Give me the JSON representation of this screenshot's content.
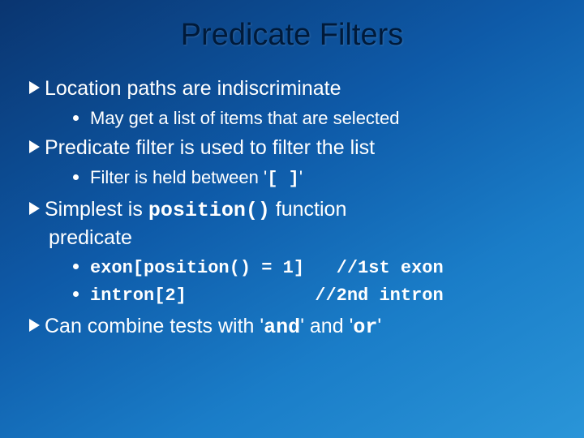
{
  "title": "Predicate Filters",
  "items": [
    {
      "text": "Location paths are indiscriminate",
      "subs": [
        {
          "text": "May get a list of items that are selected"
        }
      ]
    },
    {
      "text": "Predicate filter is used to filter the list",
      "subs": [
        {
          "prefix": "Filter is held between '",
          "code": "[ ]",
          "suffix": "'"
        }
      ]
    },
    {
      "prefix": "Simplest is ",
      "code": "position()",
      "suffix_line1": " function",
      "suffix_line2": "predicate",
      "subs": [
        {
          "code": "exon[position() = 1]   //1st exon"
        },
        {
          "code": "intron[2]            //2nd intron"
        }
      ]
    },
    {
      "prefix": "Can combine tests with '",
      "code1": "and",
      "mid": "' and '",
      "code2": "or",
      "suffix": "'"
    }
  ]
}
